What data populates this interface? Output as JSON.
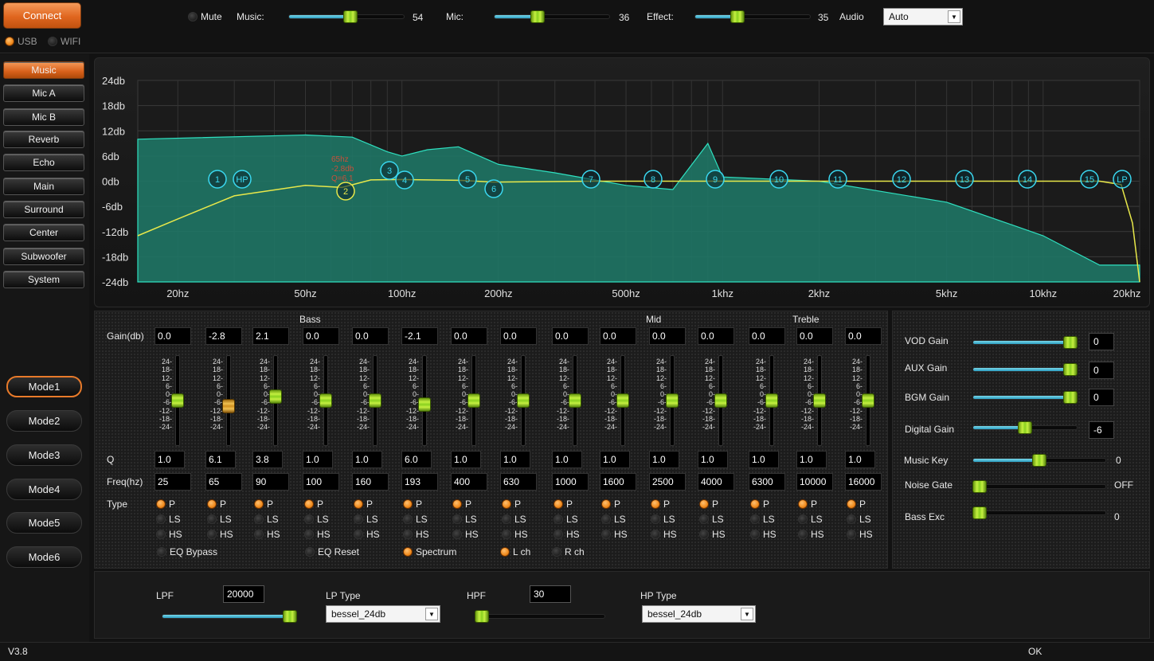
{
  "topbar": {
    "connect_label": "Connect",
    "mute_label": "Mute",
    "music_label": "Music:",
    "music_value": "54",
    "music_level": 0.54,
    "mic_label": "Mic:",
    "mic_value": "36",
    "mic_level": 0.36,
    "effect_label": "Effect:",
    "effect_value": "35",
    "effect_level": 0.35,
    "audio_label": "Audio",
    "audio_selected": "Auto",
    "usb_label": "USB",
    "wifi_label": "WIFI"
  },
  "sidebar": {
    "items": [
      "Music",
      "Mic A",
      "Mic B",
      "Reverb",
      "Echo",
      "Main",
      "Surround",
      "Center",
      "Subwoofer",
      "System"
    ],
    "active": "Music",
    "modes": [
      "Mode1",
      "Mode2",
      "Mode3",
      "Mode4",
      "Mode5",
      "Mode6"
    ],
    "active_mode": "Mode1"
  },
  "chart": {
    "y_ticks": [
      "24db",
      "18db",
      "12db",
      "6db",
      "0db",
      "-6db",
      "-12db",
      "-18db",
      "-24db"
    ],
    "x_ticks": [
      "20hz",
      "50hz",
      "100hz",
      "200hz",
      "500hz",
      "1khz",
      "2khz",
      "5khz",
      "10khz",
      "20khz"
    ],
    "markers": [
      "1",
      "HP",
      "2",
      "3",
      "4",
      "5",
      "6",
      "7",
      "8",
      "9",
      "10",
      "11",
      "12",
      "13",
      "14",
      "15",
      "LP"
    ],
    "tooltip": [
      "65hz",
      "-2.8db",
      "Q=6.1"
    ],
    "colors": {
      "background": "#1a1a1a",
      "spectrum": "#2fe0c0",
      "curve": "#e8e84a",
      "marker": "#3ad8f0"
    }
  },
  "chart_data": {
    "type": "line",
    "x_scale": "log",
    "xlim": [
      15,
      20000
    ],
    "ylim": [
      -24,
      24
    ],
    "x_ticks": [
      20,
      50,
      100,
      200,
      500,
      1000,
      2000,
      5000,
      10000,
      20000
    ],
    "series": [
      {
        "values": [
          [
            15,
            -13
          ],
          [
            20,
            -9
          ],
          [
            30,
            -3.5
          ],
          [
            50,
            -1
          ],
          [
            65,
            -1.5
          ],
          [
            80,
            0.3
          ],
          [
            100,
            0.4
          ],
          [
            150,
            0.2
          ],
          [
            193,
            -0.2
          ],
          [
            400,
            0
          ],
          [
            1000,
            0
          ],
          [
            5000,
            0
          ],
          [
            15000,
            0
          ],
          [
            17500,
            -0.8
          ],
          [
            19000,
            -10
          ],
          [
            20000,
            -24
          ]
        ]
      },
      {
        "values": [
          [
            15,
            10
          ],
          [
            50,
            11
          ],
          [
            70,
            10.5
          ],
          [
            90,
            7
          ],
          [
            100,
            6
          ],
          [
            120,
            7.5
          ],
          [
            150,
            8.2
          ],
          [
            200,
            4
          ],
          [
            300,
            2
          ],
          [
            500,
            -1
          ],
          [
            700,
            -2
          ],
          [
            900,
            9
          ],
          [
            1000,
            1
          ],
          [
            2000,
            0
          ],
          [
            5000,
            -5
          ],
          [
            10000,
            -13
          ],
          [
            15000,
            -20
          ],
          [
            20000,
            -20
          ]
        ]
      }
    ]
  },
  "eq": {
    "section_labels": {
      "bass": "Bass",
      "mid": "Mid",
      "treble": "Treble"
    },
    "row_labels": {
      "gain": "Gain(db)",
      "q": "Q",
      "freq": "Freq(hz)",
      "type": "Type"
    },
    "scale": [
      "24-",
      "18-",
      "12-",
      "6-",
      "0-",
      "-6-",
      "-12-",
      "-18-",
      "-24-"
    ],
    "type_options": [
      "P",
      "LS",
      "HS"
    ],
    "bands": [
      {
        "gain": "0.0",
        "q": "1.0",
        "freq": "25",
        "type": "P"
      },
      {
        "gain": "-2.8",
        "q": "6.1",
        "freq": "65",
        "type": "P"
      },
      {
        "gain": "2.1",
        "q": "3.8",
        "freq": "90",
        "type": "P"
      },
      {
        "gain": "0.0",
        "q": "1.0",
        "freq": "100",
        "type": "P"
      },
      {
        "gain": "0.0",
        "q": "1.0",
        "freq": "160",
        "type": "P"
      },
      {
        "gain": "-2.1",
        "q": "6.0",
        "freq": "193",
        "type": "P"
      },
      {
        "gain": "0.0",
        "q": "1.0",
        "freq": "400",
        "type": "P"
      },
      {
        "gain": "0.0",
        "q": "1.0",
        "freq": "630",
        "type": "P"
      },
      {
        "gain": "0.0",
        "q": "1.0",
        "freq": "1000",
        "type": "P"
      },
      {
        "gain": "0.0",
        "q": "1.0",
        "freq": "1600",
        "type": "P"
      },
      {
        "gain": "0.0",
        "q": "1.0",
        "freq": "2500",
        "type": "P"
      },
      {
        "gain": "0.0",
        "q": "1.0",
        "freq": "4000",
        "type": "P"
      },
      {
        "gain": "0.0",
        "q": "1.0",
        "freq": "6300",
        "type": "P"
      },
      {
        "gain": "0.0",
        "q": "1.0",
        "freq": "10000",
        "type": "P"
      },
      {
        "gain": "0.0",
        "q": "1.0",
        "freq": "16000",
        "type": "P"
      }
    ],
    "selected_band": 1,
    "options": {
      "eq_bypass": "EQ Bypass",
      "eq_reset": "EQ Reset",
      "spectrum": "Spectrum",
      "l_ch": "L ch",
      "r_ch": "R ch"
    }
  },
  "right_panel": {
    "vod_gain": {
      "label": "VOD Gain",
      "value": "0",
      "level": 1.0
    },
    "aux_gain": {
      "label": "AUX Gain",
      "value": "0",
      "level": 1.0
    },
    "bgm_gain": {
      "label": "BGM Gain",
      "value": "0",
      "level": 1.0
    },
    "digital_gain": {
      "label": "Digital Gain",
      "value": "-6",
      "level": 0.5
    },
    "music_key": {
      "label": "Music Key",
      "value": "0",
      "level": 0.5
    },
    "noise_gate": {
      "label": "Noise Gate",
      "value": "OFF",
      "level": 0.0
    },
    "bass_exc": {
      "label": "Bass Exc",
      "value": "0",
      "level": 0.0
    }
  },
  "bottom": {
    "lpf_label": "LPF",
    "lpf_value": "20000",
    "lpf_level": 1.0,
    "lp_type_label": "LP Type",
    "lp_type": "bessel_24db",
    "hpf_label": "HPF",
    "hpf_value": "30",
    "hpf_level": 0.0,
    "hp_type_label": "HP Type",
    "hp_type": "bessel_24db"
  },
  "status": {
    "version": "V3.8",
    "state": "OK"
  }
}
